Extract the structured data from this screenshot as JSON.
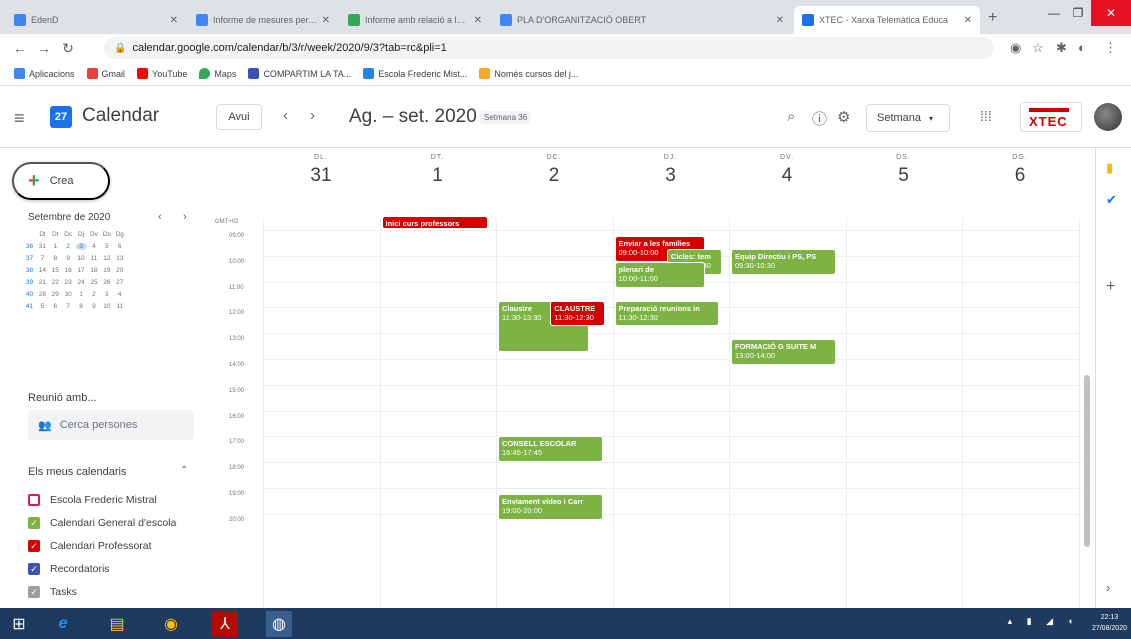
{
  "browser": {
    "tabs": [
      {
        "label": "EdenD",
        "active": false
      },
      {
        "label": "Informe de mesures per a l'obe",
        "active": false
      },
      {
        "label": "Informe amb relació a les mes",
        "active": false
      },
      {
        "label": "PLA D'ORGANITZACIÓ OBERT",
        "active": false
      },
      {
        "label": "XTEC - Xarxa Telemàtica Educa",
        "active": true
      }
    ],
    "url": "calendar.google.com/calendar/b/3/r/week/2020/9/3?tab=rc&pli=1",
    "bookmarks": [
      "Aplicacions",
      "Gmail",
      "YouTube",
      "Maps",
      "COMPARTIM LA TA...",
      "Escola Frederic Mist...",
      "Només cursos del j..."
    ]
  },
  "header": {
    "app_title": "Calendar",
    "logo_day": "27",
    "today_label": "Avui",
    "range_title": "Ag. – set. 2020",
    "week_badge": "Setmana 36",
    "view_label": "Setmana",
    "brand": "XTEC"
  },
  "sidebar": {
    "create_label": "Crea",
    "mini_month": "Setembre de 2020",
    "mini_weekdays": [
      "Dl",
      "Dt",
      "Dc",
      "Dj",
      "Dv",
      "Ds",
      "Dg"
    ],
    "mini_weeks": [
      {
        "wk": "36",
        "days": [
          "31",
          "1",
          "2",
          "3",
          "4",
          "5",
          "6"
        ]
      },
      {
        "wk": "37",
        "days": [
          "7",
          "8",
          "9",
          "10",
          "11",
          "12",
          "13"
        ]
      },
      {
        "wk": "38",
        "days": [
          "14",
          "15",
          "16",
          "17",
          "18",
          "19",
          "20"
        ]
      },
      {
        "wk": "39",
        "days": [
          "21",
          "22",
          "23",
          "24",
          "25",
          "26",
          "27"
        ]
      },
      {
        "wk": "40",
        "days": [
          "28",
          "29",
          "30",
          "1",
          "2",
          "3",
          "4"
        ]
      },
      {
        "wk": "41",
        "days": [
          "5",
          "6",
          "7",
          "8",
          "9",
          "10",
          "11"
        ]
      }
    ],
    "meet_title": "Reunió amb...",
    "search_placeholder": "Cerca persones",
    "mycals_title": "Els meus calendaris",
    "calendars": [
      {
        "label": "Escola Frederic Mistral",
        "color": "#d81b60",
        "checked": false
      },
      {
        "label": "Calendari General d'escola",
        "color": "#7cb342",
        "checked": true
      },
      {
        "label": "Calendari Professorat",
        "color": "#d50000",
        "checked": true
      },
      {
        "label": "Recordatoris",
        "color": "#3f51b5",
        "checked": true
      },
      {
        "label": "Tasks",
        "color": "#9e9e9e",
        "checked": true
      }
    ]
  },
  "week": {
    "tz": "GMT+02",
    "days": [
      {
        "name": "DL.",
        "date": "31"
      },
      {
        "name": "DT.",
        "date": "1"
      },
      {
        "name": "DC.",
        "date": "2"
      },
      {
        "name": "DJ.",
        "date": "3"
      },
      {
        "name": "DV.",
        "date": "4"
      },
      {
        "name": "DS.",
        "date": "5"
      },
      {
        "name": "DG.",
        "date": "6"
      }
    ],
    "hours": [
      "09:00",
      "10:00",
      "11:00",
      "12:00",
      "13:00",
      "14:00",
      "15:00",
      "16:00",
      "17:00",
      "18:00",
      "19:00",
      "20:00"
    ],
    "allday_events": [
      {
        "title": "Inici curs professors",
        "day": 1,
        "color": "#d50000"
      }
    ],
    "events": [
      {
        "title": "Enviar a les famílies",
        "time": "09:00-10:00",
        "day": 3,
        "start": 9.0,
        "end": 10.0,
        "color": "red",
        "slot": 0,
        "width": 0.78
      },
      {
        "title": "Cicles: tem",
        "time": "09:30-10:30",
        "day": 3,
        "start": 9.5,
        "end": 10.5,
        "color": "green",
        "slot": 0.45,
        "width": 0.47
      },
      {
        "title": "plenari de",
        "time": "10:00-11:00",
        "day": 3,
        "start": 10.0,
        "end": 11.0,
        "color": "green",
        "slot": 0,
        "width": 0.78
      },
      {
        "title": "Equip Directiu i PS, PS",
        "time": "09:30-10:30",
        "day": 4,
        "start": 9.5,
        "end": 10.5,
        "color": "green",
        "slot": 0,
        "width": 0.9
      },
      {
        "title": "Claustre",
        "time": "11:30-13:30",
        "day": 2,
        "start": 11.5,
        "end": 13.5,
        "color": "green",
        "slot": 0,
        "width": 0.78
      },
      {
        "title": "CLAUSTRE",
        "time": "11:30-12:30",
        "day": 2,
        "start": 11.5,
        "end": 12.5,
        "color": "red",
        "slot": 0.45,
        "width": 0.47
      },
      {
        "title": "Preparació reunions in",
        "time": "11:30-12:30",
        "day": 3,
        "start": 11.5,
        "end": 12.5,
        "color": "green",
        "slot": 0,
        "width": 0.9
      },
      {
        "title": "FORMACIÓ G SUITE M",
        "time": "13:00-14:00",
        "day": 4,
        "start": 13.0,
        "end": 14.0,
        "color": "green",
        "slot": 0,
        "width": 0.9
      },
      {
        "title": "CONSELL ESCOLAR",
        "time": "16:45-17:45",
        "day": 2,
        "start": 16.75,
        "end": 17.75,
        "color": "green",
        "slot": 0,
        "width": 0.9
      },
      {
        "title": "Enviament vídeo i Carr",
        "time": "19:00-20:00",
        "day": 2,
        "start": 19.0,
        "end": 20.0,
        "color": "green",
        "slot": 0,
        "width": 0.9
      }
    ]
  },
  "taskbar": {
    "time": "22:13",
    "date": "27/08/2020"
  }
}
